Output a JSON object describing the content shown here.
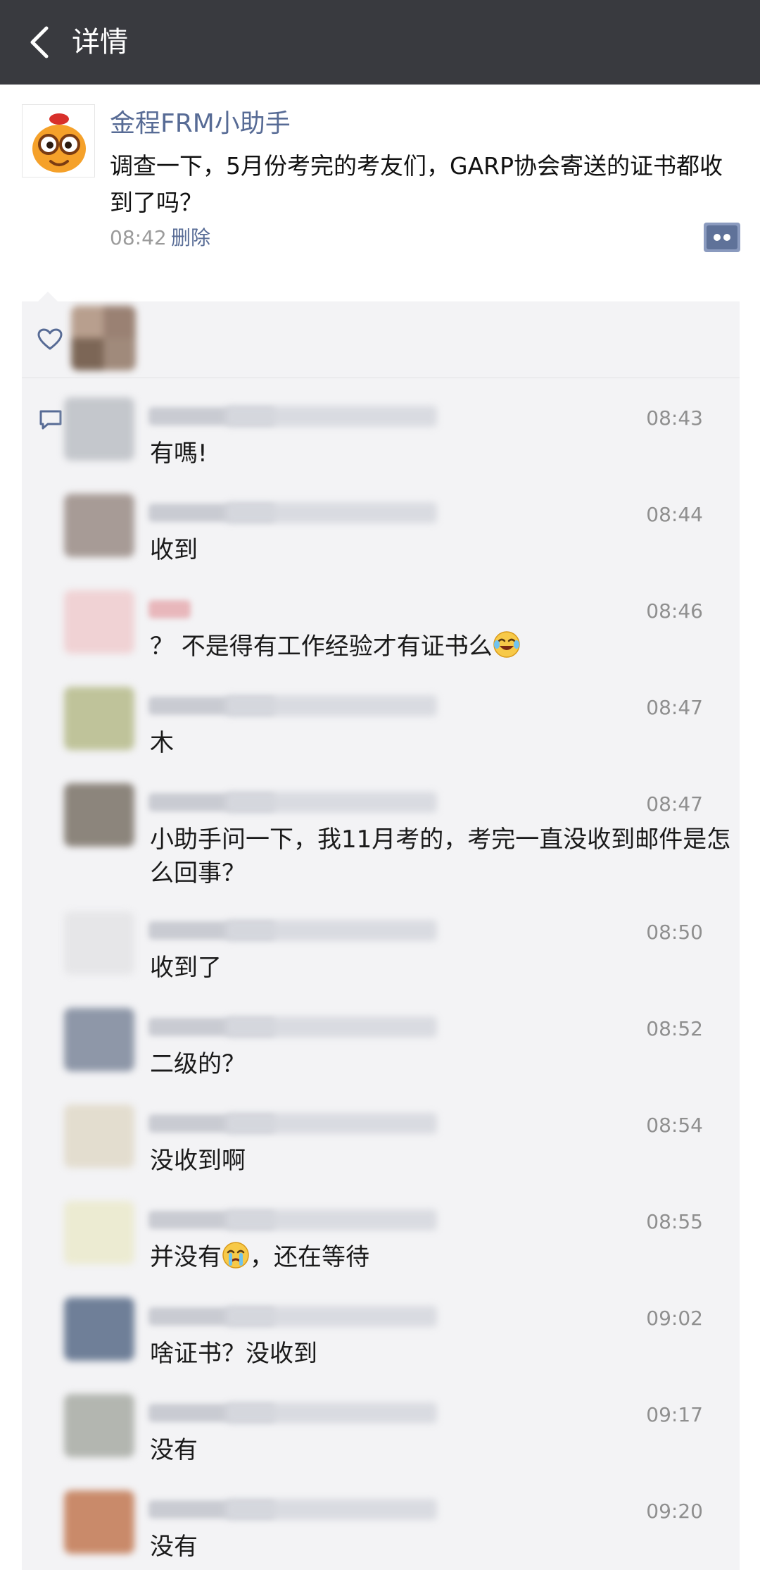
{
  "header": {
    "title": "详情"
  },
  "post": {
    "author": "金程FRM小助手",
    "text": "调查一下，5月份考完的考友们，GARP协会寄送的证书都收到了吗？",
    "time": "08:42",
    "delete_label": "删除"
  },
  "comments": [
    {
      "time": "08:43",
      "text": "有嗎!"
    },
    {
      "time": "08:44",
      "text": "收到"
    },
    {
      "time": "08:46",
      "text": "？ 不是得有工作经验才有证书么",
      "emoji": "laughing-tears"
    },
    {
      "time": "08:47",
      "text": "木"
    },
    {
      "time": "08:47",
      "text": "小助手问一下，我11月考的，考完一直没收到邮件是怎么回事？"
    },
    {
      "time": "08:50",
      "text": "收到了"
    },
    {
      "time": "08:52",
      "text": "二级的？"
    },
    {
      "time": "08:54",
      "text": "没收到啊"
    },
    {
      "time": "08:55",
      "text_before": "并没有",
      "text_after": "，还在等待",
      "emoji": "crying"
    },
    {
      "time": "09:02",
      "text": "啥证书？没收到"
    },
    {
      "time": "09:17",
      "text": "没有"
    },
    {
      "time": "09:20",
      "text": "没有"
    }
  ],
  "colors": {
    "header_bg": "#393a3f",
    "link": "#576b95",
    "comments_bg": "#f3f3f5"
  }
}
